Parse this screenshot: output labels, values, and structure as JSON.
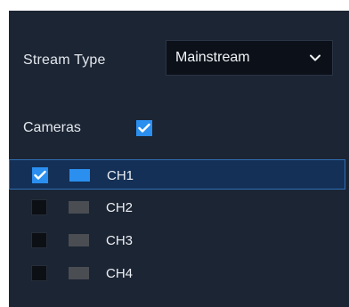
{
  "stream": {
    "label": "Stream Type",
    "selected": "Mainstream"
  },
  "cameras": {
    "label": "Cameras",
    "all_checked": true
  },
  "channels": [
    {
      "label": "CH1",
      "checked": true,
      "selected": true,
      "swatch_color": "#2b8ff0"
    },
    {
      "label": "CH2",
      "checked": false,
      "selected": false,
      "swatch_color": "#4a4d52"
    },
    {
      "label": "CH3",
      "checked": false,
      "selected": false,
      "swatch_color": "#4a4d52"
    },
    {
      "label": "CH4",
      "checked": false,
      "selected": false,
      "swatch_color": "#4a4d52"
    }
  ],
  "colors": {
    "panel_bg": "#1c2533",
    "accent": "#2b8ff0",
    "selected_row_bg": "#143056",
    "selected_row_border": "#2f6fb5"
  },
  "icons": {
    "dropdown": "chevron-down-icon",
    "check": "checkmark-icon"
  }
}
